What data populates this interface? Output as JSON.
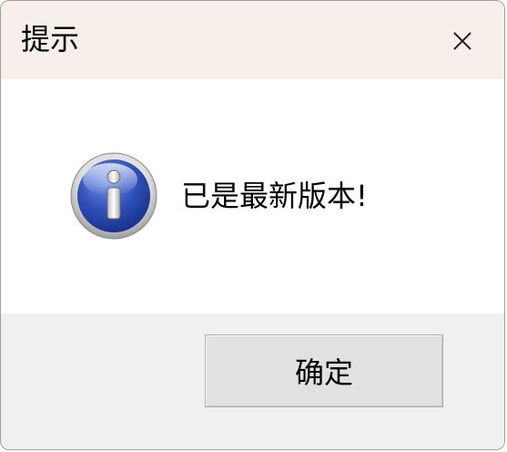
{
  "dialog": {
    "title": "提示",
    "close_icon": "close-icon",
    "message": "已是最新版本!",
    "message_icon": "information-icon",
    "ok_label": "确定"
  },
  "colors": {
    "titlebar_bg": "#f7efea",
    "footer_bg": "#f0f0f0",
    "button_bg": "#e1e1e1",
    "icon_blue": "#2f4fb8"
  }
}
